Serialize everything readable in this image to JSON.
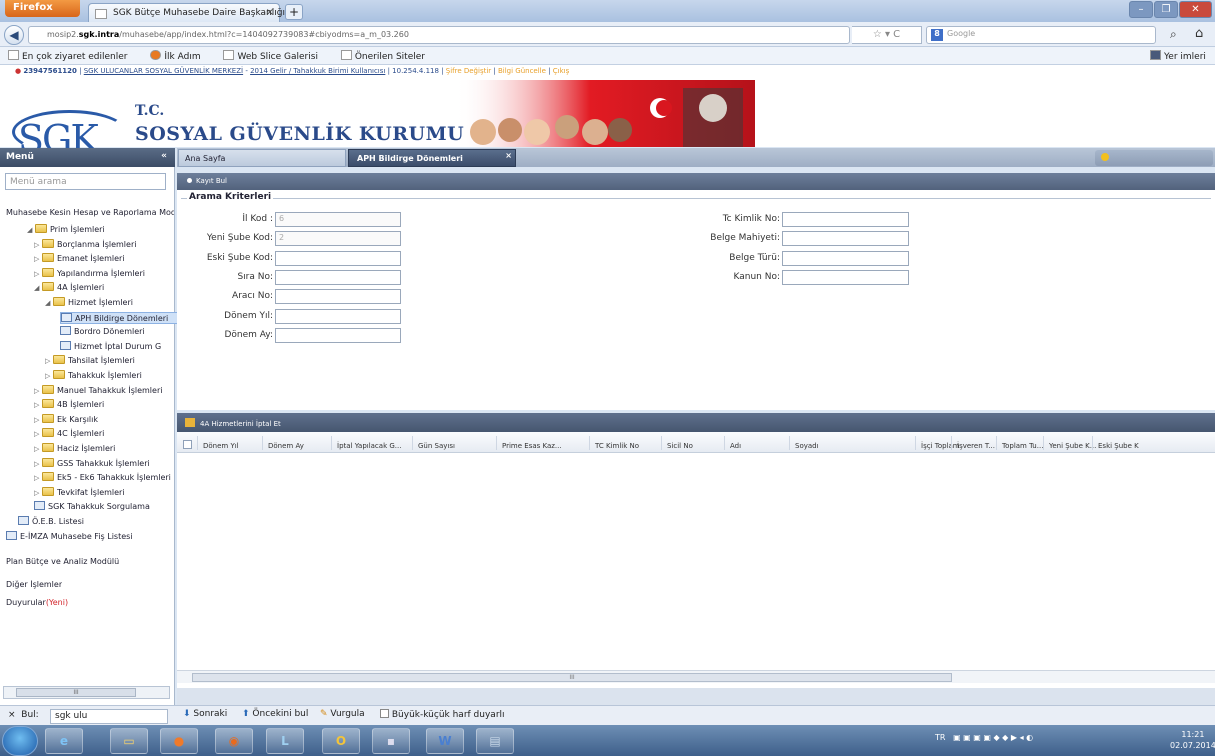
{
  "browser": {
    "app_button": "Firefox",
    "tab_title": "SGK Bütçe Muhasebe Daire Başkanlığı",
    "new_tab": "+",
    "url_prefix": "mosip2.",
    "url_host": "sgk.intra",
    "url_rest": "/muhasebe/app/index.html?c=1404092739083#cbiyodms=a_m_03.260",
    "search_placeholder": "Google",
    "bookmarks": [
      "En çok ziyaret edilenler",
      "İlk Adım",
      "Web Slice Galerisi",
      "Önerilen Siteler"
    ],
    "other_bookmarks": "Yer imleri"
  },
  "header": {
    "user_id": "23947561120",
    "org": "SGK ULUCANLAR SOSYAL GÜVENLİK MERKEZİ",
    "role": "2014 Gelir / Tahakkuk Birimi Kullanıcısı",
    "ip": "10.254.4.118",
    "links": [
      "Şifre Değiştir",
      "Bilgi Güncelle",
      "Çıkış"
    ],
    "logo": "SGK",
    "tc": "T.C.",
    "kurum": "SOSYAL GÜVENLİK KURUMU"
  },
  "menu": {
    "title": "Menü",
    "search_placeholder": "Menü arama",
    "root": "Muhasebe Kesin Hesap ve Raporlama Mod",
    "items": [
      {
        "label": "Prim İşlemleri",
        "level": 1,
        "type": "folder",
        "open": true
      },
      {
        "label": "Borçlanma İşlemleri",
        "level": 2,
        "type": "folder"
      },
      {
        "label": "Emanet İşlemleri",
        "level": 2,
        "type": "folder"
      },
      {
        "label": "Yapılandırma İşlemleri",
        "level": 2,
        "type": "folder"
      },
      {
        "label": "4A İşlemleri",
        "level": 2,
        "type": "folder",
        "open": true
      },
      {
        "label": "Hizmet İşlemleri",
        "level": 3,
        "type": "folder",
        "open": true
      },
      {
        "label": "APH Bildirge Dönemleri",
        "level": 4,
        "type": "doc",
        "selected": true
      },
      {
        "label": "Bordro Dönemleri",
        "level": 4,
        "type": "doc"
      },
      {
        "label": "Hizmet İptal Durum G",
        "level": 4,
        "type": "doc"
      },
      {
        "label": "Tahsilat İşlemleri",
        "level": 3,
        "type": "folder"
      },
      {
        "label": "Tahakkuk İşlemleri",
        "level": 3,
        "type": "folder"
      },
      {
        "label": "Manuel Tahakkuk İşlemleri",
        "level": 2,
        "type": "folder"
      },
      {
        "label": "4B İşlemleri",
        "level": 2,
        "type": "folder"
      },
      {
        "label": "Ek Karşılık",
        "level": 2,
        "type": "folder"
      },
      {
        "label": "4C İşlemleri",
        "level": 2,
        "type": "folder"
      },
      {
        "label": "Haciz İşlemleri",
        "level": 2,
        "type": "folder"
      },
      {
        "label": "GSS Tahakkuk İşlemleri",
        "level": 2,
        "type": "folder"
      },
      {
        "label": "Ek5 - Ek6 Tahakkuk İşlemleri",
        "level": 2,
        "type": "folder"
      },
      {
        "label": "Tevkifat İşlemleri",
        "level": 2,
        "type": "folder"
      },
      {
        "label": "SGK Tahakkuk Sorgulama",
        "level": 2,
        "type": "doc"
      },
      {
        "label": "Ö.E.B. Listesi",
        "level": 1,
        "type": "doc"
      },
      {
        "label": "E-İMZA Muhasebe Fiş Listesi",
        "level": 0,
        "type": "doc"
      }
    ],
    "sections": [
      "Plan Bütçe ve Analiz Modülü",
      "Diğer İşlemler"
    ],
    "duyurular": "Duyurular",
    "duyurular_new": "(Yeni)"
  },
  "tabs": {
    "home": "Ana Sayfa",
    "active": "APH Bildirge Dönemleri",
    "close": "×"
  },
  "form": {
    "toolbar": "Kayıt Bul",
    "legend": "Arama Kriterleri",
    "left_fields": [
      {
        "label": "İl Kod :",
        "value": "6"
      },
      {
        "label": "Yeni Şube Kod:",
        "value": "2"
      },
      {
        "label": "Eski Şube Kod:",
        "value": ""
      },
      {
        "label": "Sıra No:",
        "value": ""
      },
      {
        "label": "Aracı No:",
        "value": ""
      },
      {
        "label": "Dönem Yıl:",
        "value": ""
      },
      {
        "label": "Dönem Ay:",
        "value": ""
      }
    ],
    "right_fields": [
      {
        "label": "Tc Kimlik No:",
        "value": ""
      },
      {
        "label": "Belge Mahiyeti:",
        "value": ""
      },
      {
        "label": "Belge Türü:",
        "value": ""
      },
      {
        "label": "Kanun No:",
        "value": ""
      }
    ]
  },
  "grid": {
    "title": "4A Hizmetlerini İptal Et",
    "columns": [
      "Dönem Yıl",
      "Dönem Ay",
      "İptal Yapılacak G...",
      "Gün Sayısı",
      "Prime Esas Kaz...",
      "TC Kimlik No",
      "Sicil No",
      "Adı",
      "Soyadı",
      "İşçi Toplam",
      "İşveren T...",
      "Toplam Tu...",
      "Yeni Şube K...",
      "Eski Şube K"
    ]
  },
  "findbar": {
    "close": "×",
    "label": "Bul:",
    "value": "sgk ulu",
    "next": "Sonraki",
    "prev": "Öncekini bul",
    "highlight": "Vurgula",
    "match_case": "Büyük-küçük harf duyarlı"
  },
  "taskbar": {
    "lang": "TR",
    "time": "11:21",
    "date": "02.07.2014"
  }
}
